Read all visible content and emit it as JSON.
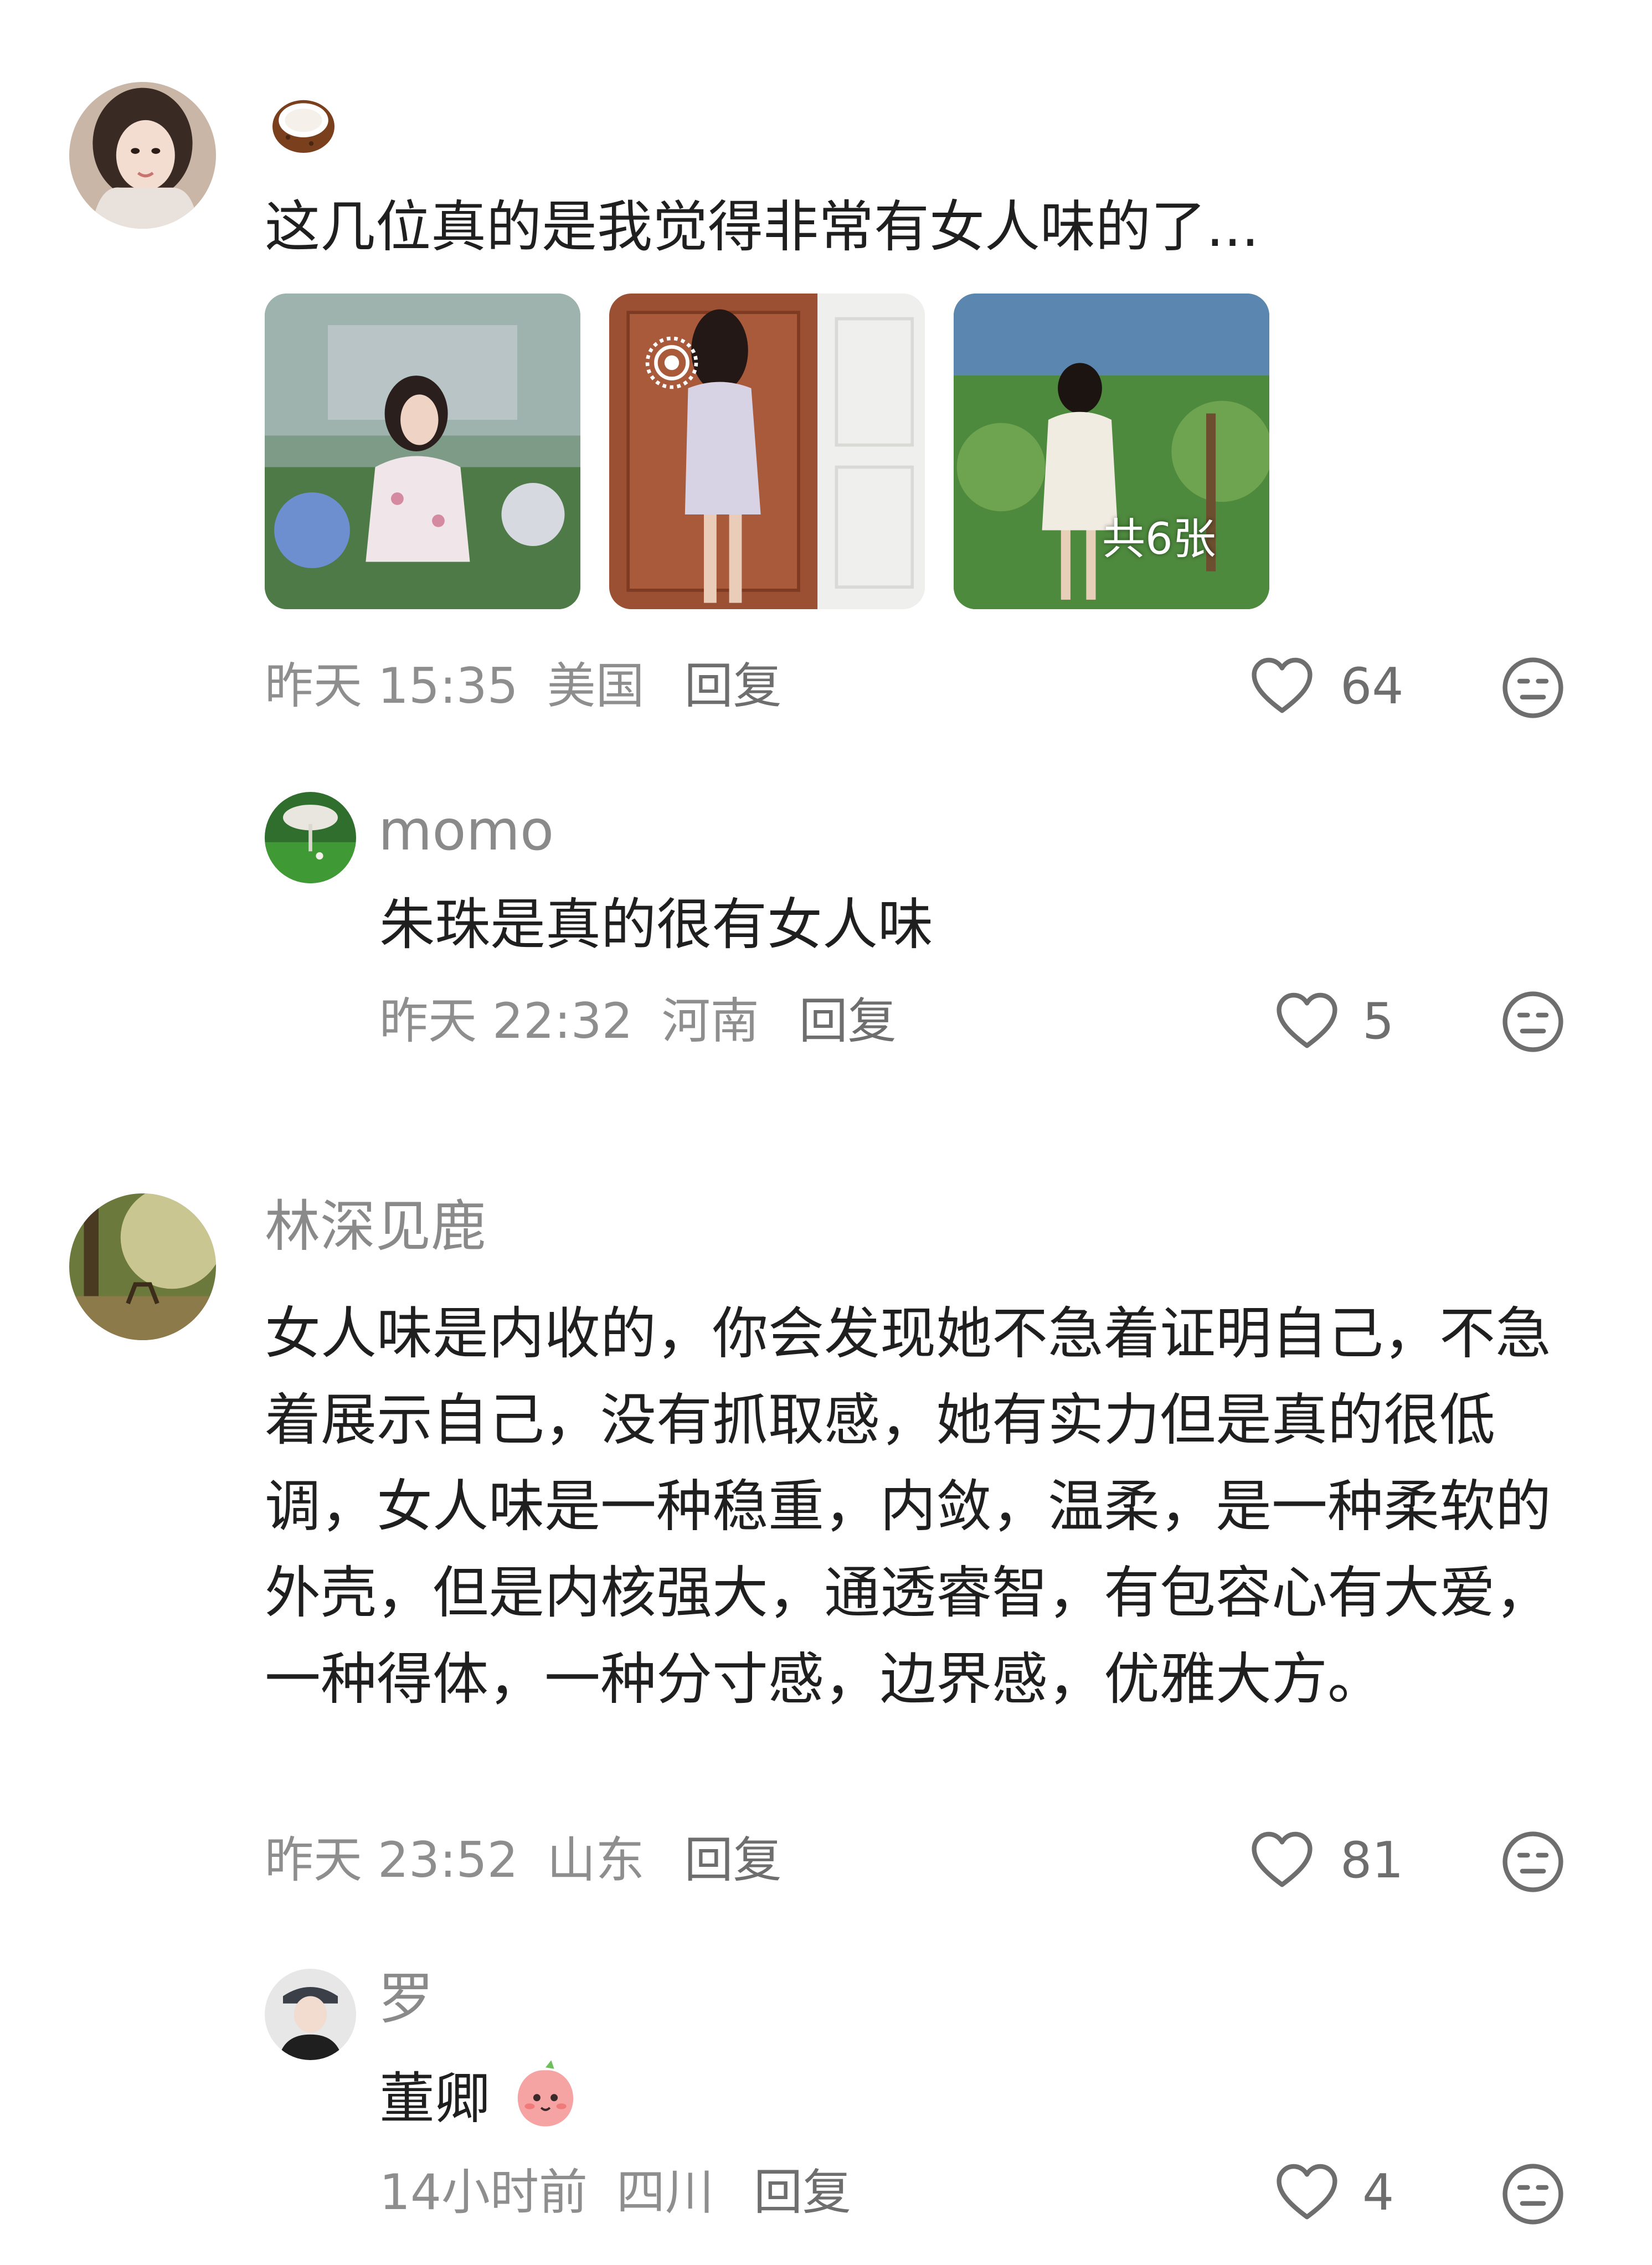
{
  "comments": [
    {
      "user": "",
      "user_icon": "coconut-icon",
      "text": "这几位真的是我觉得非常有女人味的了...",
      "images": {
        "overlay_label": "共6张"
      },
      "time": "昨天 15:35",
      "location": "美国",
      "reply_label": "回复",
      "likes": "64"
    },
    {
      "user": "momo",
      "text": "朱珠是真的很有女人味",
      "time": "昨天 22:32",
      "location": "河南",
      "reply_label": "回复",
      "likes": "5"
    },
    {
      "user": "林深见鹿",
      "text": "女人味是内收的，你会发现她不急着证明自己，不急着展示自己，没有抓取感，她有实力但是真的很低调，女人味是一种稳重，内敛，温柔，是一种柔软的外壳，但是内核强大，通透睿智，有包容心有大爱，一种得体，一种分寸感，边界感，优雅大方。",
      "time": "昨天 23:52",
      "location": "山东",
      "reply_label": "回复",
      "likes": "81"
    },
    {
      "user": "罗",
      "text": "董卿",
      "text_emoji": "peach-face-emoji",
      "time": "14小时前",
      "location": "四川",
      "reply_label": "回复",
      "likes": "4"
    }
  ],
  "colors": {
    "text": "#1f1f1f",
    "name": "#8a8a8a",
    "meta": "#8e8e8e"
  }
}
